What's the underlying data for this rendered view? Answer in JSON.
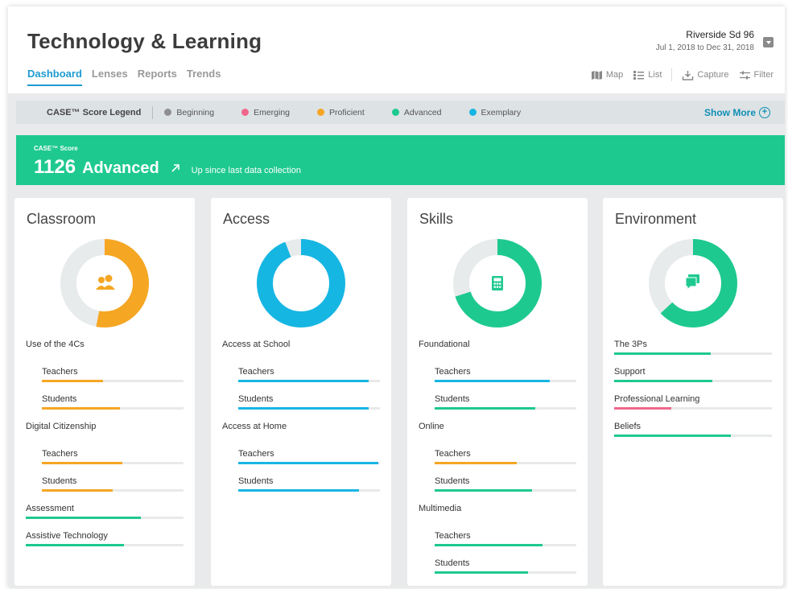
{
  "header": {
    "title": "Technology & Learning",
    "district": "Riverside Sd 96",
    "date_range": "Jul 1, 2018 to Dec 31, 2018",
    "tabs": [
      {
        "label": "Dashboard",
        "active": true
      },
      {
        "label": "Lenses"
      },
      {
        "label": "Reports"
      },
      {
        "label": "Trends"
      }
    ],
    "tools": {
      "map": "Map",
      "list": "List",
      "capture": "Capture",
      "filter": "Filter"
    }
  },
  "legend": {
    "title": "CASE™ Score Legend",
    "items": [
      {
        "label": "Beginning",
        "color": "#8f8f8f"
      },
      {
        "label": "Emerging",
        "color": "#f0678b"
      },
      {
        "label": "Proficient",
        "color": "#f5a623"
      },
      {
        "label": "Advanced",
        "color": "#1ec98f"
      },
      {
        "label": "Exemplary",
        "color": "#16b6e3"
      }
    ],
    "show_more": "Show More"
  },
  "score": {
    "label": "CASE™ Score",
    "value": "1126",
    "level": "Advanced",
    "trend": "Up since last data collection",
    "color": "#1ec98f"
  },
  "cards": [
    {
      "title": "Classroom",
      "icon": "users-icon",
      "color": "#f5a623",
      "fraction": 0.53,
      "metrics": [
        {
          "label": "Use of the 4Cs",
          "section": true
        },
        {
          "label": "Teachers",
          "indent": true,
          "value": 0.43,
          "color": "#f5a623"
        },
        {
          "label": "Students",
          "indent": true,
          "value": 0.55,
          "color": "#f5a623"
        },
        {
          "label": "Digital Citizenship",
          "section": true
        },
        {
          "label": "Teachers",
          "indent": true,
          "value": 0.57,
          "color": "#f5a623"
        },
        {
          "label": "Students",
          "indent": true,
          "value": 0.5,
          "color": "#f5a623"
        },
        {
          "label": "Assessment",
          "value": 0.73,
          "color": "#1ec98f"
        },
        {
          "label": "Assistive Technology",
          "value": 0.62,
          "color": "#1ec98f"
        }
      ]
    },
    {
      "title": "Access",
      "icon": "wifi-icon",
      "color": "#16b6e3",
      "fraction": 0.94,
      "metrics": [
        {
          "label": "Access at School",
          "section": true
        },
        {
          "label": "Teachers",
          "indent": true,
          "value": 0.92,
          "color": "#16b6e3"
        },
        {
          "label": "Students",
          "indent": true,
          "value": 0.92,
          "color": "#16b6e3"
        },
        {
          "label": "Access at Home",
          "section": true
        },
        {
          "label": "Teachers",
          "indent": true,
          "value": 0.99,
          "color": "#16b6e3"
        },
        {
          "label": "Students",
          "indent": true,
          "value": 0.85,
          "color": "#16b6e3"
        }
      ]
    },
    {
      "title": "Skills",
      "icon": "calculator-icon",
      "color": "#1ec98f",
      "fraction": 0.7,
      "metrics": [
        {
          "label": "Foundational",
          "section": true
        },
        {
          "label": "Teachers",
          "indent": true,
          "value": 0.81,
          "color": "#16b6e3"
        },
        {
          "label": "Students",
          "indent": true,
          "value": 0.71,
          "color": "#1ec98f"
        },
        {
          "label": "Online",
          "section": true
        },
        {
          "label": "Teachers",
          "indent": true,
          "value": 0.58,
          "color": "#f5a623"
        },
        {
          "label": "Students",
          "indent": true,
          "value": 0.69,
          "color": "#1ec98f"
        },
        {
          "label": "Multimedia",
          "section": true
        },
        {
          "label": "Teachers",
          "indent": true,
          "value": 0.76,
          "color": "#1ec98f"
        },
        {
          "label": "Students",
          "indent": true,
          "value": 0.66,
          "color": "#1ec98f"
        }
      ]
    },
    {
      "title": "Environment",
      "icon": "chat-icon",
      "color": "#1ec98f",
      "fraction": 0.63,
      "metrics": [
        {
          "label": "The 3Ps",
          "value": 0.61,
          "color": "#1ec98f"
        },
        {
          "label": "Support",
          "value": 0.62,
          "color": "#1ec98f"
        },
        {
          "label": "Professional Learning",
          "value": 0.36,
          "color": "#f0678b"
        },
        {
          "label": "Beliefs",
          "value": 0.74,
          "color": "#1ec98f"
        }
      ]
    }
  ]
}
